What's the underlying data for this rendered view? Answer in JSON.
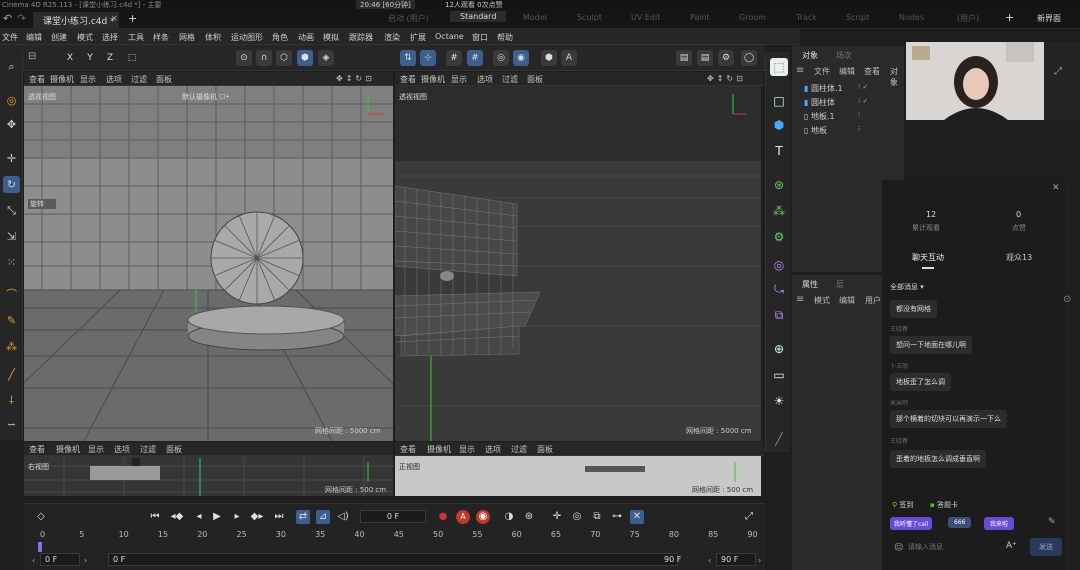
{
  "window": {
    "title": "Cinema 4D R25.113 - [课堂小练习.c4d *] - 主要",
    "recording_status": "20:46 [60分钟]",
    "viewers": "12人观看 0次点赞"
  },
  "tabs": {
    "file_tab": "课堂小练习.c4d *",
    "close_glyph": "✕",
    "add_glyph": "+"
  },
  "layouts": {
    "items": [
      "启动 (用户)",
      "Standard",
      "Model",
      "Sculpt",
      "UV Edit",
      "Paint",
      "Groom",
      "Track",
      "Script",
      "Nodes",
      "(用户)"
    ],
    "add": "+",
    "new_layout": "新界面"
  },
  "menu": [
    "文件",
    "编辑",
    "创建",
    "模式",
    "选择",
    "工具",
    "样条",
    "网格",
    "体积",
    "运动图形",
    "角色",
    "动画",
    "模拟",
    "跟踪器",
    "渲染",
    "扩展",
    "Octane",
    "窗口",
    "帮助"
  ],
  "toolbar": {
    "axes": [
      "X",
      "Y",
      "Z"
    ]
  },
  "viewport_menu": [
    "查看",
    "摄像机",
    "显示",
    "选项",
    "过滤",
    "面板"
  ],
  "viewports": {
    "top_left": {
      "label": "透视视图",
      "camera": "默认摄像机 ☐•",
      "hud": "旋转"
    },
    "top_right": {
      "label": "透视视图",
      "grid": "网格间距 : 5000 cm"
    },
    "top_left_grid": "网格间距 : 5000 cm",
    "bottom_left": {
      "label": "右视图",
      "grid": "网格间距 : 500 cm"
    },
    "bottom_right": {
      "label": "正视图",
      "grid": "网格间距 : 500 cm"
    }
  },
  "object_manager": {
    "tabs": [
      "对象",
      "场次"
    ],
    "menu": [
      "文件",
      "编辑",
      "查看",
      "对象"
    ],
    "objects": [
      "圆柱体.1",
      "圆柱体",
      "地板.1",
      "地板"
    ]
  },
  "attributes": {
    "tabs": [
      "属性",
      "层"
    ],
    "menu": [
      "模式",
      "编辑",
      "用户"
    ]
  },
  "chat": {
    "close": "✕",
    "stats": [
      {
        "value": "12",
        "label": "累计观看"
      },
      {
        "value": "0",
        "label": "点赞"
      }
    ],
    "tabs": [
      "聊天互动",
      "观众13"
    ],
    "filter": "全部消息",
    "messages": [
      {
        "sender": "",
        "text": "都没有网格"
      },
      {
        "sender": "王晓春",
        "text": "想问一下地面在哪儿啊"
      },
      {
        "sender": "卜玉丽",
        "text": "地板歪了怎么调"
      },
      {
        "sender": "米米吧",
        "text": "那个横着的切块可以再演示一下么"
      },
      {
        "sender": "王晓春",
        "text": "歪着的地板怎么调成垂直啊"
      }
    ],
    "actions": [
      "签到",
      "答题卡"
    ],
    "quick": [
      "我听懂了call",
      "666",
      "我来啦"
    ],
    "input_placeholder": "请输入消息",
    "send": "发送"
  },
  "timeline": {
    "ruler": [
      "0",
      "5",
      "10",
      "15",
      "20",
      "25",
      "30",
      "35",
      "40",
      "45",
      "50",
      "55",
      "60",
      "65",
      "70",
      "75",
      "80",
      "85",
      "90"
    ],
    "current_frame": "0 F",
    "start": "0 F",
    "start2": "0 F",
    "end": "90 F",
    "end2": "90 F"
  },
  "colors": {
    "accent": "#3d5f8f",
    "record": "#c0392b",
    "chat_quick": "#6a4bd8"
  }
}
